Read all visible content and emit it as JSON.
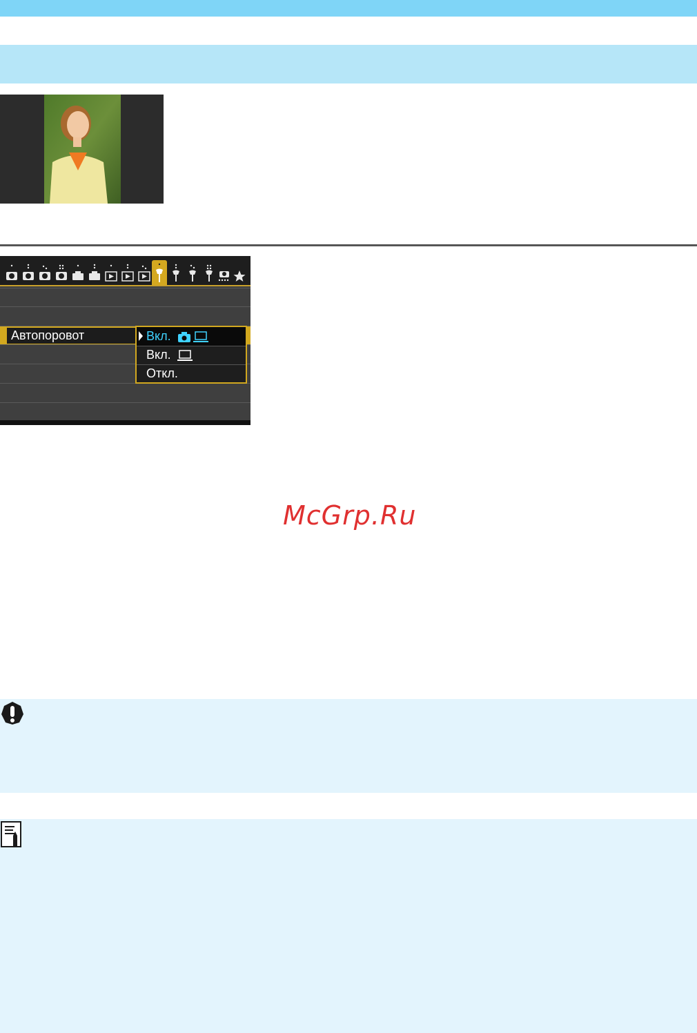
{
  "menu": {
    "item_label": "Автопоровот",
    "options": [
      "Вкл.",
      "Вкл.",
      "Откл."
    ],
    "selected_index": 0
  },
  "watermark": "McGrp.Ru",
  "colors": {
    "top_bar": "#7fd5f7",
    "section_bar": "#b6e6f8",
    "note_bg": "#e3f4fd",
    "menu_accent": "#d2a81f",
    "selected_option": "#3fd2ff",
    "watermark": "#e03030"
  },
  "icons": {
    "caution": "exclamation-icon",
    "note": "memo-pencil-icon"
  }
}
